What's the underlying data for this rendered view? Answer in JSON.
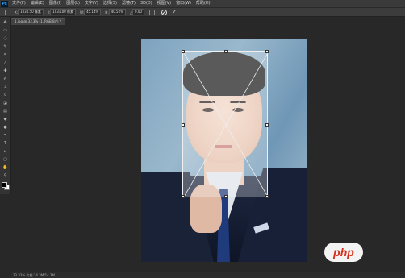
{
  "app": {
    "logo_text": "Ps"
  },
  "menu": {
    "items": [
      "文件(F)",
      "编辑(E)",
      "图像(I)",
      "图层(L)",
      "文字(Y)",
      "选择(S)",
      "滤镜(T)",
      "3D(D)",
      "视图(V)",
      "窗口(W)",
      "帮助(H)"
    ]
  },
  "options": {
    "x_label": "X:",
    "x_value": "1030.50 像素",
    "y_label": "Y:",
    "y_value": "1031.00 像素",
    "w_label": "W:",
    "w_value": "45.14%",
    "h_label": "H:",
    "h_value": "40.52%",
    "angle_label": "△",
    "angle_value": "0.00"
  },
  "document": {
    "tab_label": "1.jpg @ 33.3% (1, RGB/8#) *"
  },
  "status": {
    "text": "33.33%   文档:14.3M/14.3M"
  },
  "watermark": {
    "text": "php"
  },
  "colors": {
    "accent": "#31a8ff",
    "background": "#282828",
    "watermark_red": "#d4301f"
  }
}
